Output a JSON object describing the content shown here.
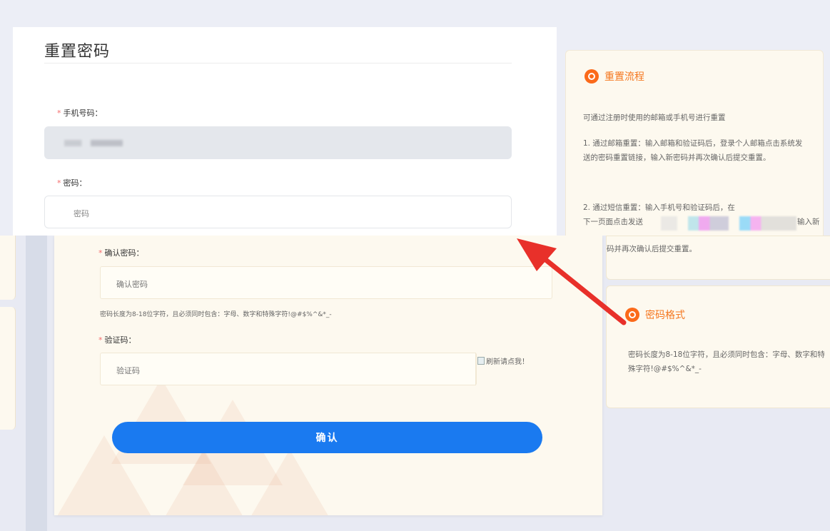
{
  "form": {
    "title": "重置密码",
    "phone_label": "手机号码：",
    "password_label": "密码：",
    "password_placeholder": "密码",
    "confirm_label": "确认密码：",
    "confirm_placeholder": "确认密码",
    "password_hint": "密码长度为8-18位字符，且必须同时包含：字母、数字和特殊字符!@#$%^&*_-",
    "code_label": "验证码：",
    "code_placeholder": "验证码",
    "captcha_alt": "刷新请点我！",
    "submit_label": "确认"
  },
  "process": {
    "title": "重置流程",
    "intro": "可通过注册时使用的邮箱或手机号进行重置",
    "step1": "1. 通过邮箱重置：输入邮箱和验证码后，登录个人邮箱点击系统发送的密码重置链接，输入新密码并再次确认后提交重置。",
    "step2_prefix": "2. 通过短信重置：输入手机号和验证码后，在",
    "step2_line2_start": "下一页面点击发送",
    "step2_line2_end": "输入新",
    "step2_tail": "码并再次确认后提交重置。"
  },
  "format": {
    "title": "密码格式",
    "text": "密码长度为8-18位字符，且必须同时包含：字母、数字和特殊字符!@#$%^&*_-"
  },
  "colors": {
    "accent_orange": "#f5771f",
    "primary_blue": "#1a7af0",
    "arrow_red": "#e8302a"
  }
}
